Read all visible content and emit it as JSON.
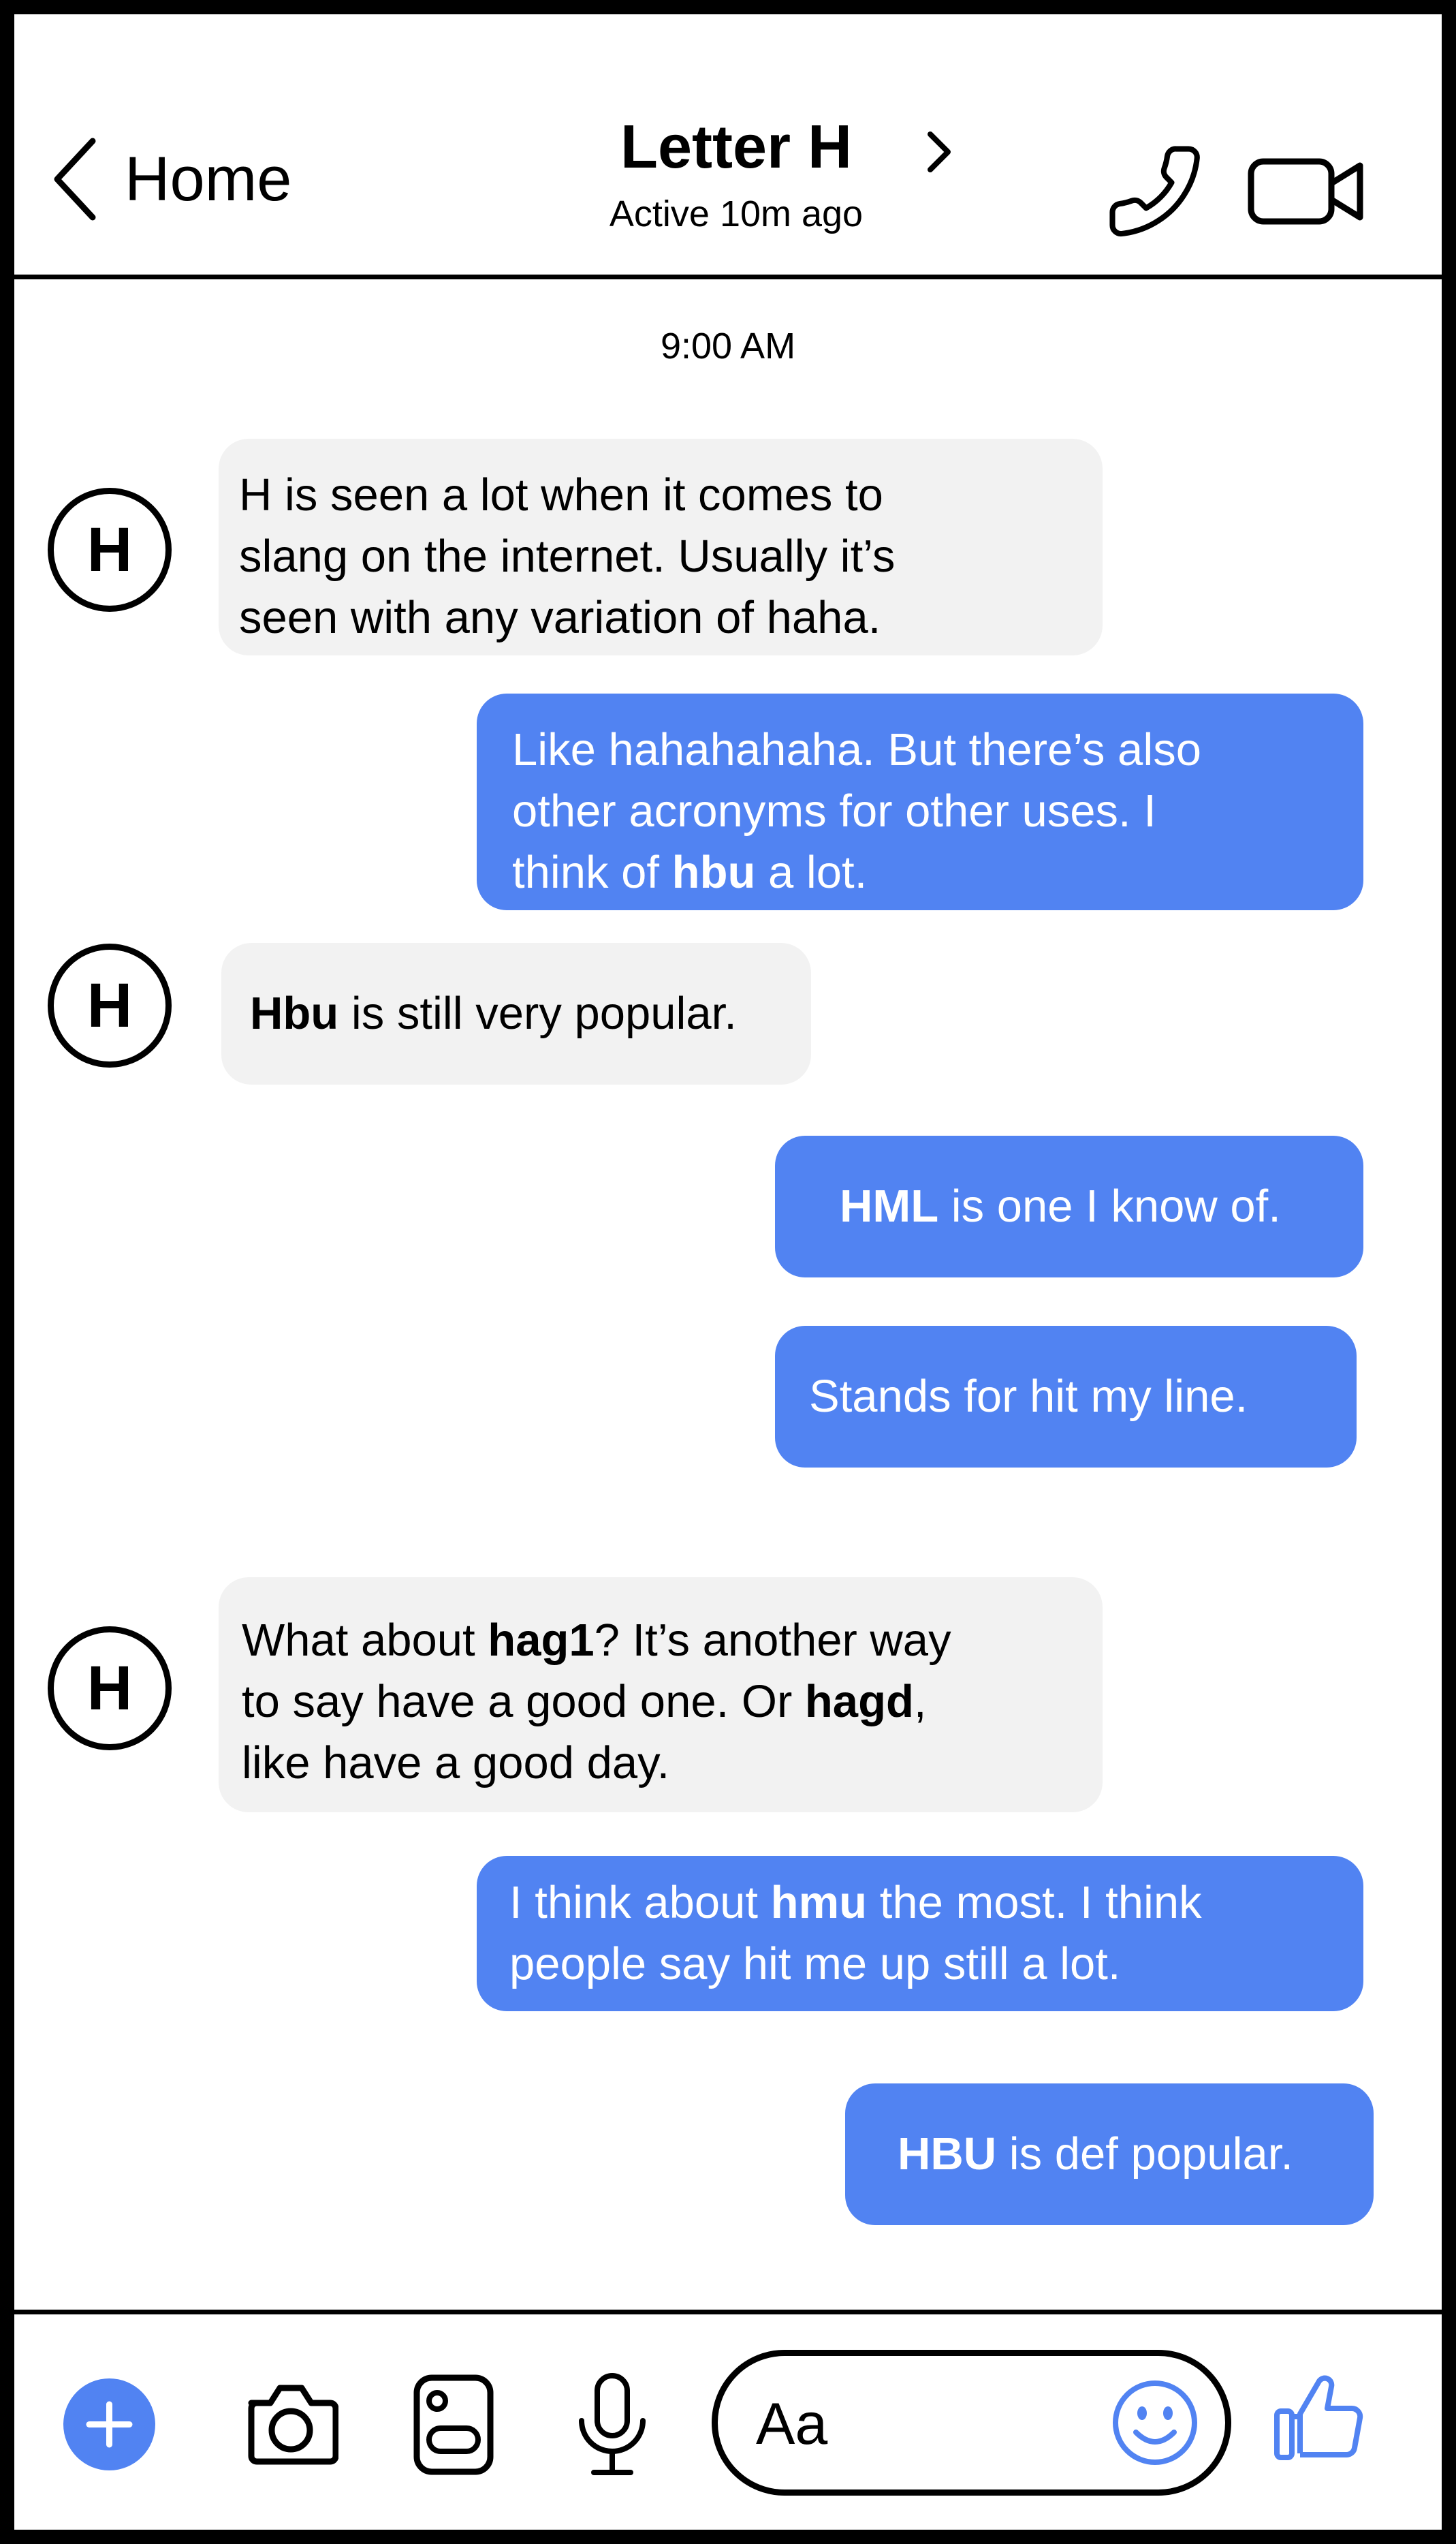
{
  "header": {
    "back_label": "Home",
    "contact_name": "Letter H",
    "status": "Active 10m ago"
  },
  "timestamp": "9:00 AM",
  "avatar_letter": "H",
  "messages": [
    {
      "from": "contact",
      "lines": [
        "H is seen a lot when it comes to",
        "slang on the internet. Usually it’s",
        "seen with any variation of haha."
      ]
    },
    {
      "from": "me",
      "lines": [
        "Like hahahahaha. But there’s also",
        "other acronyms for other uses. I",
        "think of hbu a lot."
      ],
      "bold": [
        "hbu"
      ]
    },
    {
      "from": "contact",
      "lines": [
        "Hbu is still very popular."
      ],
      "bold": [
        "Hbu"
      ]
    },
    {
      "from": "me",
      "lines": [
        "HML is one I know of."
      ],
      "bold": [
        "HML"
      ]
    },
    {
      "from": "me",
      "lines": [
        "Stands for hit my line."
      ]
    },
    {
      "from": "contact",
      "lines": [
        "What about hag1? It’s another way",
        "to say have a good one. Or hagd,",
        "like have a good day."
      ],
      "bold": [
        "hag1",
        "hagd"
      ]
    },
    {
      "from": "me",
      "lines": [
        "I think about hmu the most. I think",
        "people say hit me up still a lot."
      ],
      "bold": [
        "hmu"
      ]
    },
    {
      "from": "me",
      "lines": [
        "HBU is def popular."
      ],
      "bold": [
        "HBU"
      ]
    }
  ],
  "composer": {
    "placeholder": "Aa",
    "icons": [
      "plus-icon",
      "camera-icon",
      "photo-icon",
      "microphone-icon",
      "emoji-icon",
      "thumbs-up-icon"
    ]
  },
  "colors": {
    "accent": "#5183f2",
    "incoming_bubble": "#f2f2f2",
    "outgoing_text": "#ffffff",
    "border": "#000000"
  }
}
